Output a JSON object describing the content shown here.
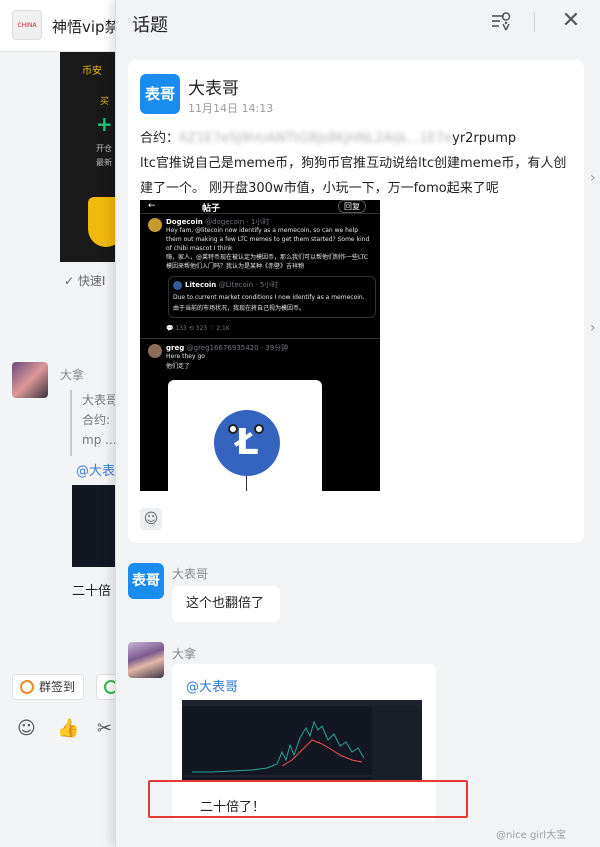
{
  "background_chat": {
    "group_name": "神悟vip禁",
    "group_avatar_text": "CHINA",
    "card_tag": "币安",
    "card_line1": "买",
    "card_line2": "开仓",
    "card_line3": "最新",
    "quick_reply": "快速I",
    "sender_name": "大拿",
    "quote_lines": [
      "大表哥",
      "合约:",
      "mp ..."
    ],
    "at_mention": "@大表",
    "message_20x": "二十倍",
    "checkin_button": "群签到"
  },
  "panel": {
    "title": "话题"
  },
  "topic": {
    "author_avatar_text": "表哥",
    "author": "大表哥",
    "time": "11月14日 14:13",
    "contract_label": "合约：",
    "contract_blurred": "6Z1E7e5J9hUANTtG8Js8KjHNL2AIjk...1E7e",
    "contract_suffix": "yr2rpump",
    "body": "ltc官推说自己是meme币，狗狗币官推互动说给ltc创建meme币，有人创建了一个。 刚开盘300w市值，小玩一下，万一fomo起来了呢"
  },
  "tweet": {
    "back": "←",
    "header": "帖子",
    "reply_btn": "回复",
    "dogecoin_name": "Dogecoin",
    "dogecoin_handle": "@dogecoin · 1小时",
    "dogecoin_text": "Hey fam, @litecoin now identify as a memecoin, so can we help them out making a few LTC memes to get them started? Some kind of chibi mascot I think",
    "dogecoin_cn": "嗨，家人，@莱特币现在被认定为模因币，那么我们可以帮他们制作一些LTC 模因来帮他们入门吗？我认为是某种《赤壁》吉祥物",
    "litecoin_name": "Litecoin",
    "litecoin_handle": "@Litecoin · 5小时",
    "litecoin_text": "Due to current market conditions I now identify as a memecoin.",
    "litecoin_cn": "由于当前的市场状况，我现在将自己视为模因币。",
    "actions": "💬 133   ⟲ 323   ♡ 2,1K",
    "greg_name": "greg",
    "greg_handle": "@greg16676935420 · 39分钟",
    "greg_text": "Here they go",
    "greg_cn": "他们走了",
    "ltc_symbol": "Ł"
  },
  "replies": [
    {
      "name": "大表哥",
      "avatar_text": "表哥",
      "text": "这个也翻倍了"
    },
    {
      "name": "大拿",
      "at": "@大表哥",
      "text": "二十倍了！"
    }
  ],
  "watermark": "@nice girl大宝",
  "icons": {
    "location": "location-icon",
    "close": "close-icon",
    "emoji": "emoji-icon",
    "like": "thumbs-up-icon",
    "scissors": "scissors-icon"
  },
  "colors": {
    "accent": "#1a8cf0",
    "mention": "#2f7bd6",
    "highlight_box": "#e53935"
  }
}
